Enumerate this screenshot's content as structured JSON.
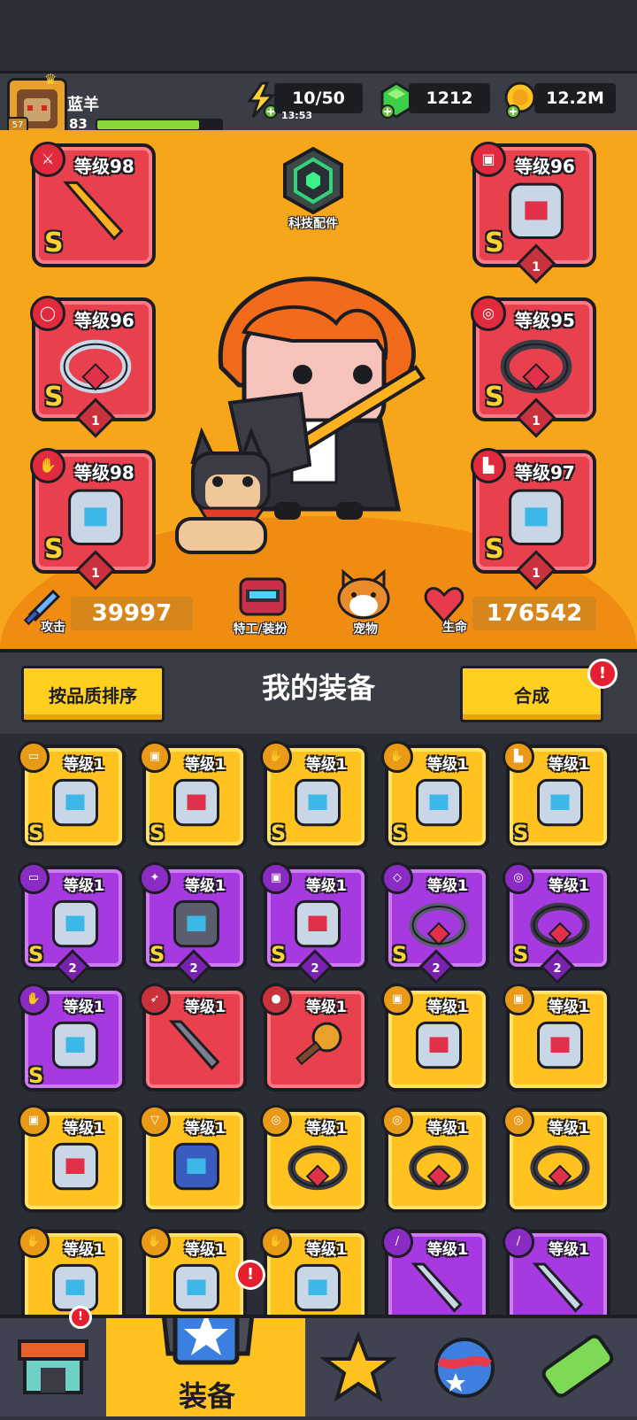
{
  "player": {
    "name": "蓝羊",
    "level": "83",
    "avatar_level": "57",
    "xp_fraction": 0.82
  },
  "resources": {
    "energy": {
      "value": "10/50",
      "timer": "13:53",
      "icon": "lightning-icon"
    },
    "gems": {
      "value": "1212",
      "icon": "green-gem-icon"
    },
    "coins": {
      "value": "12.2M",
      "icon": "gold-coin-icon"
    }
  },
  "hero": {
    "tech_parts_label": "科技配件",
    "agent_label": "特工/装扮",
    "pet_label": "宠物",
    "attack_label": "攻击",
    "attack_value": "39997",
    "hp_label": "生命",
    "hp_value": "176542",
    "slots": [
      {
        "level": "等级98",
        "rank": "S",
        "stars": "",
        "icon": "sword-icon"
      },
      {
        "level": "等级96",
        "rank": "S",
        "stars": "1",
        "icon": "ring-icon"
      },
      {
        "level": "等级98",
        "rank": "S",
        "stars": "1",
        "icon": "glove-icon"
      },
      {
        "level": "等级96",
        "rank": "S",
        "stars": "1",
        "icon": "armor-icon"
      },
      {
        "level": "等级95",
        "rank": "S",
        "stars": "1",
        "icon": "belt-icon"
      },
      {
        "level": "等级97",
        "rank": "S",
        "stars": "1",
        "icon": "boot-icon"
      }
    ]
  },
  "equipment": {
    "sort_button": "按品质排序",
    "title": "我的装备",
    "merge_button": "合成",
    "merge_alert": "!",
    "items": [
      {
        "level": "等级1",
        "rank": "S",
        "gem": "",
        "color": "gold",
        "icon": "gun-icon"
      },
      {
        "level": "等级1",
        "rank": "S",
        "gem": "",
        "color": "gold",
        "icon": "armor-icon"
      },
      {
        "level": "等级1",
        "rank": "S",
        "gem": "",
        "color": "gold",
        "icon": "glove-icon"
      },
      {
        "level": "等级1",
        "rank": "S",
        "gem": "",
        "color": "gold",
        "icon": "glove-icon"
      },
      {
        "level": "等级1",
        "rank": "S",
        "gem": "",
        "color": "gold",
        "icon": "boot-icon"
      },
      {
        "level": "等级1",
        "rank": "S",
        "gem": "2",
        "color": "purple",
        "icon": "gun-icon"
      },
      {
        "level": "等级1",
        "rank": "S",
        "gem": "2",
        "color": "purple",
        "icon": "shuriken-icon"
      },
      {
        "level": "等级1",
        "rank": "S",
        "gem": "2",
        "color": "purple",
        "icon": "armor-icon"
      },
      {
        "level": "等级1",
        "rank": "S",
        "gem": "2",
        "color": "purple",
        "icon": "necklace-icon"
      },
      {
        "level": "等级1",
        "rank": "S",
        "gem": "2",
        "color": "purple",
        "icon": "belt-icon"
      },
      {
        "level": "等级1",
        "rank": "S",
        "gem": "",
        "color": "purple",
        "icon": "glove-icon"
      },
      {
        "level": "等级1",
        "rank": "",
        "gem": "",
        "color": "red",
        "icon": "kunai-icon"
      },
      {
        "level": "等级1",
        "rank": "",
        "gem": "",
        "color": "red",
        "icon": "microphone-icon"
      },
      {
        "level": "等级1",
        "rank": "",
        "gem": "",
        "color": "gold",
        "icon": "armor-icon"
      },
      {
        "level": "等级1",
        "rank": "",
        "gem": "",
        "color": "gold",
        "icon": "armor-icon"
      },
      {
        "level": "等级1",
        "rank": "",
        "gem": "",
        "color": "gold",
        "icon": "armor-icon"
      },
      {
        "level": "等级1",
        "rank": "",
        "gem": "",
        "color": "gold",
        "icon": "amulet-icon"
      },
      {
        "level": "等级1",
        "rank": "",
        "gem": "",
        "color": "gold",
        "icon": "belt-icon"
      },
      {
        "level": "等级1",
        "rank": "",
        "gem": "",
        "color": "gold",
        "icon": "belt-icon"
      },
      {
        "level": "等级1",
        "rank": "",
        "gem": "",
        "color": "gold",
        "icon": "belt-icon"
      },
      {
        "level": "等级1",
        "rank": "",
        "gem": "",
        "color": "gold",
        "icon": "glove-icon"
      },
      {
        "level": "等级1",
        "rank": "",
        "gem": "",
        "color": "gold",
        "icon": "glove-icon"
      },
      {
        "level": "等级1",
        "rank": "",
        "gem": "",
        "color": "gold",
        "icon": "glove-icon"
      },
      {
        "level": "等级1",
        "rank": "",
        "gem": "",
        "color": "purple",
        "icon": "blade-icon"
      },
      {
        "level": "等级1",
        "rank": "",
        "gem": "",
        "color": "purple",
        "icon": "blade-icon"
      }
    ]
  },
  "nav": {
    "active_label": "装备",
    "alert": "!",
    "items": [
      "shop-icon",
      "equipment-icon",
      "battle-star-icon",
      "planet-icon",
      "lab-capsule-icon"
    ]
  },
  "colors": {
    "orange": "#f7a51a",
    "gold": "#ffc21f",
    "purple": "#a63ae0",
    "red": "#e9404d",
    "dark": "#1c1d22"
  }
}
